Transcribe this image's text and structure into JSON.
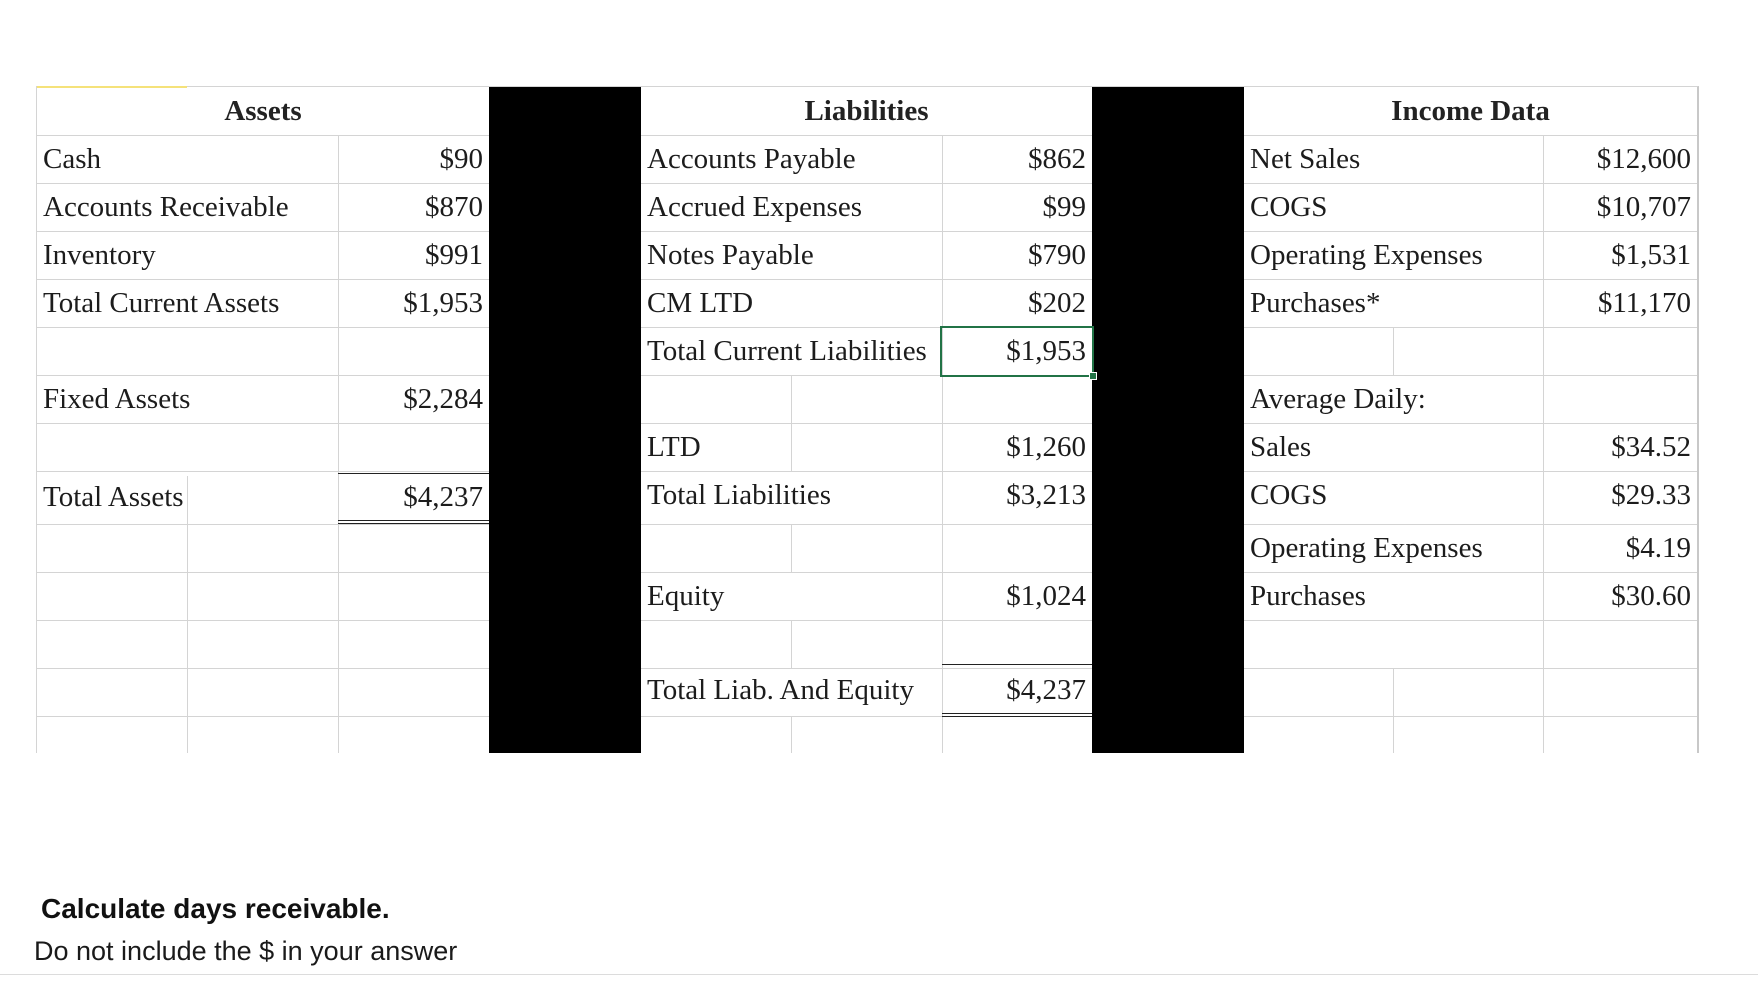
{
  "assets": {
    "header": "Assets",
    "rows": [
      {
        "label": "Cash",
        "value": "$90"
      },
      {
        "label": "Accounts Receivable",
        "value": "$870"
      },
      {
        "label": "Inventory",
        "value": "$991"
      },
      {
        "label": "Total Current Assets",
        "value": "$1,953"
      }
    ],
    "fixed": {
      "label": "Fixed Assets",
      "value": "$2,284"
    },
    "total": {
      "label": "Total Assets",
      "value": "$4,237"
    }
  },
  "liabilities": {
    "header": "Liabilities",
    "rows": [
      {
        "label": "Accounts Payable",
        "value": "$862"
      },
      {
        "label": "Accrued Expenses",
        "value": "$99"
      },
      {
        "label": "Notes Payable",
        "value": "$790"
      },
      {
        "label": "CM LTD",
        "value": "$202"
      },
      {
        "label": "Total Current Liabilities",
        "value": "$1,953"
      }
    ],
    "ltd": {
      "label": "LTD",
      "value": "$1,260"
    },
    "total": {
      "label": "Total Liabilities",
      "value": "$3,213"
    },
    "equity": {
      "label": "Equity",
      "value": "$1,024"
    },
    "total_le": {
      "label": "Total Liab. And Equity",
      "value": "$4,237"
    }
  },
  "income": {
    "header": "Income Data",
    "rows": [
      {
        "label": "Net Sales",
        "value": "$12,600"
      },
      {
        "label": "COGS",
        "value": "$10,707"
      },
      {
        "label": "Operating Expenses",
        "value": "$1,531"
      },
      {
        "label": "Purchases*",
        "value": "$11,170"
      }
    ],
    "daily_header": "Average Daily:",
    "daily": [
      {
        "label": "Sales",
        "value": "$34.52"
      },
      {
        "label": "COGS",
        "value": "$29.33"
      },
      {
        "label": "Operating Expenses",
        "value": "$4.19"
      },
      {
        "label": "Purchases",
        "value": "$30.60"
      }
    ]
  },
  "question": {
    "prompt": "Calculate days receivable.",
    "instruction": "Do not include the $ in your answer"
  },
  "colors": {
    "gridline": "#d4d4d4",
    "redaction": "#000000",
    "selection": "#217346"
  }
}
